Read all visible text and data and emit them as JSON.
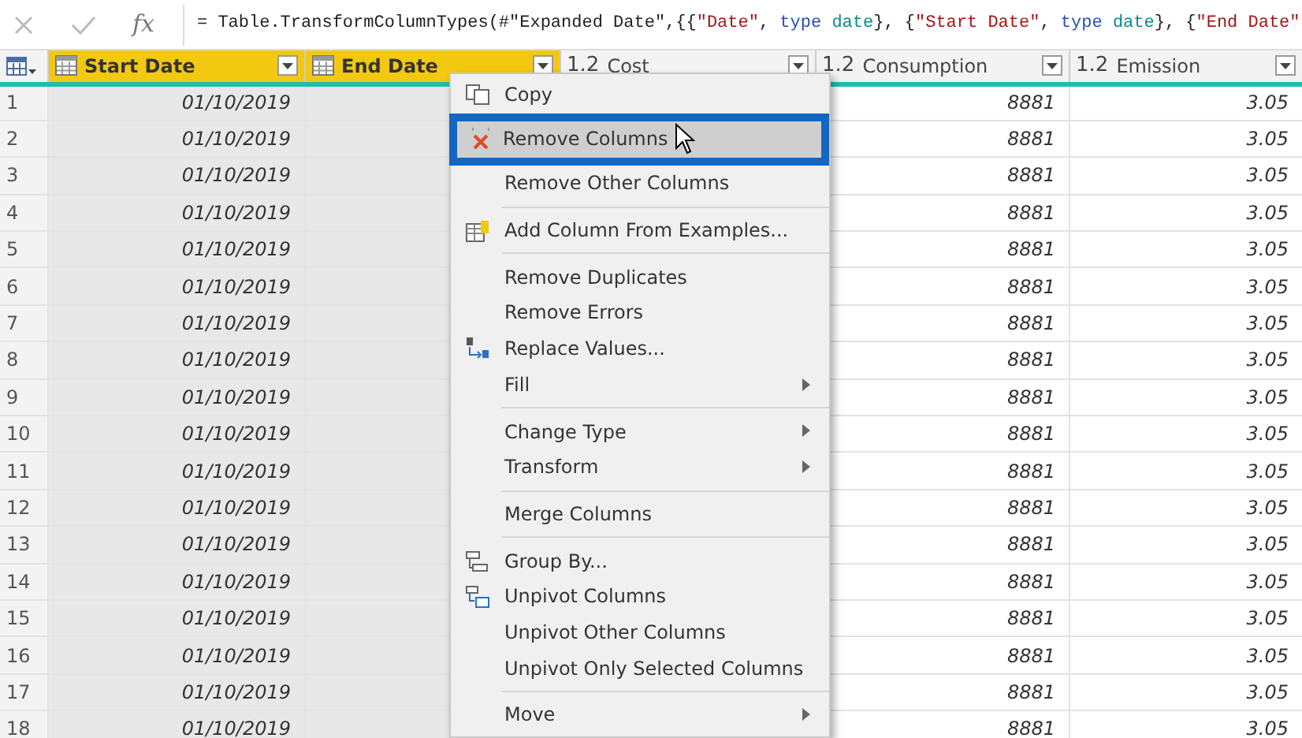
{
  "formula_bar": {
    "fx_label": "fx",
    "tokens": [
      {
        "kind": "plain",
        "text": "= Table.TransformColumnTypes(#\"Expanded Date\",{{"
      },
      {
        "kind": "string",
        "text": "\"Date\""
      },
      {
        "kind": "plain",
        "text": ", "
      },
      {
        "kind": "keyword",
        "text": "type "
      },
      {
        "kind": "typename",
        "text": "date"
      },
      {
        "kind": "plain",
        "text": "}, {"
      },
      {
        "kind": "string",
        "text": "\"Start Date\""
      },
      {
        "kind": "plain",
        "text": ", "
      },
      {
        "kind": "keyword",
        "text": "type "
      },
      {
        "kind": "typename",
        "text": "date"
      },
      {
        "kind": "plain",
        "text": "}, {"
      },
      {
        "kind": "string",
        "text": "\"End Date\""
      }
    ]
  },
  "table": {
    "columns": [
      {
        "kind": "date",
        "name": "Start Date",
        "selected": true
      },
      {
        "kind": "date",
        "name": "End Date",
        "selected": true
      },
      {
        "kind": "number",
        "type_label": "1.2",
        "name": "Cost",
        "selected": false
      },
      {
        "kind": "number",
        "type_label": "1.2",
        "name": "Consumption",
        "selected": false
      },
      {
        "kind": "number",
        "type_label": "1.2",
        "name": "Emission",
        "selected": false
      }
    ],
    "rows": [
      {
        "index": "1",
        "start_date": "01/10/2019",
        "consumption": "8881",
        "emission": "3.05"
      },
      {
        "index": "2",
        "start_date": "01/10/2019",
        "consumption": "8881",
        "emission": "3.05"
      },
      {
        "index": "3",
        "start_date": "01/10/2019",
        "consumption": "8881",
        "emission": "3.05"
      },
      {
        "index": "4",
        "start_date": "01/10/2019",
        "consumption": "8881",
        "emission": "3.05"
      },
      {
        "index": "5",
        "start_date": "01/10/2019",
        "consumption": "8881",
        "emission": "3.05"
      },
      {
        "index": "6",
        "start_date": "01/10/2019",
        "consumption": "8881",
        "emission": "3.05"
      },
      {
        "index": "7",
        "start_date": "01/10/2019",
        "consumption": "8881",
        "emission": "3.05"
      },
      {
        "index": "8",
        "start_date": "01/10/2019",
        "consumption": "8881",
        "emission": "3.05"
      },
      {
        "index": "9",
        "start_date": "01/10/2019",
        "consumption": "8881",
        "emission": "3.05"
      },
      {
        "index": "10",
        "start_date": "01/10/2019",
        "consumption": "8881",
        "emission": "3.05"
      },
      {
        "index": "11",
        "start_date": "01/10/2019",
        "consumption": "8881",
        "emission": "3.05"
      },
      {
        "index": "12",
        "start_date": "01/10/2019",
        "consumption": "8881",
        "emission": "3.05"
      },
      {
        "index": "13",
        "start_date": "01/10/2019",
        "consumption": "8881",
        "emission": "3.05"
      },
      {
        "index": "14",
        "start_date": "01/10/2019",
        "consumption": "8881",
        "emission": "3.05"
      },
      {
        "index": "15",
        "start_date": "01/10/2019",
        "consumption": "8881",
        "emission": "3.05"
      },
      {
        "index": "16",
        "start_date": "01/10/2019",
        "consumption": "8881",
        "emission": "3.05"
      },
      {
        "index": "17",
        "start_date": "01/10/2019",
        "consumption": "8881",
        "emission": "3.05"
      },
      {
        "index": "18",
        "start_date": "01/10/2019",
        "consumption": "8881",
        "emission": "3.05"
      }
    ]
  },
  "context_menu": {
    "items": [
      {
        "kind": "copy",
        "label": "Copy",
        "selected": false
      },
      {
        "kind": "remove",
        "label": "Remove Columns",
        "selected": true
      },
      {
        "kind": "plain",
        "label": "Remove Other Columns",
        "selected": false
      },
      {
        "kind": "examples",
        "label": "Add Column From Examples...",
        "selected": false,
        "separator_before": true
      },
      {
        "kind": "plain",
        "label": "Remove Duplicates",
        "selected": false,
        "separator_before": true
      },
      {
        "kind": "plain",
        "label": "Remove Errors",
        "selected": false
      },
      {
        "kind": "replace",
        "label": "Replace Values...",
        "selected": false
      },
      {
        "kind": "plain",
        "label": "Fill",
        "selected": false,
        "submenu": true
      },
      {
        "kind": "plain",
        "label": "Change Type",
        "selected": false,
        "submenu": true,
        "separator_before": true
      },
      {
        "kind": "plain",
        "label": "Transform",
        "selected": false,
        "submenu": true
      },
      {
        "kind": "plain",
        "label": "Merge Columns",
        "selected": false,
        "separator_before": true
      },
      {
        "kind": "group",
        "label": "Group By...",
        "selected": false,
        "separator_before": true
      },
      {
        "kind": "unpivot",
        "label": "Unpivot Columns",
        "selected": false
      },
      {
        "kind": "plain",
        "label": "Unpivot Other Columns",
        "selected": false
      },
      {
        "kind": "plain",
        "label": "Unpivot Only Selected Columns",
        "selected": false
      },
      {
        "kind": "plain",
        "label": "Move",
        "selected": false,
        "submenu": true,
        "separator_before": true
      }
    ]
  }
}
